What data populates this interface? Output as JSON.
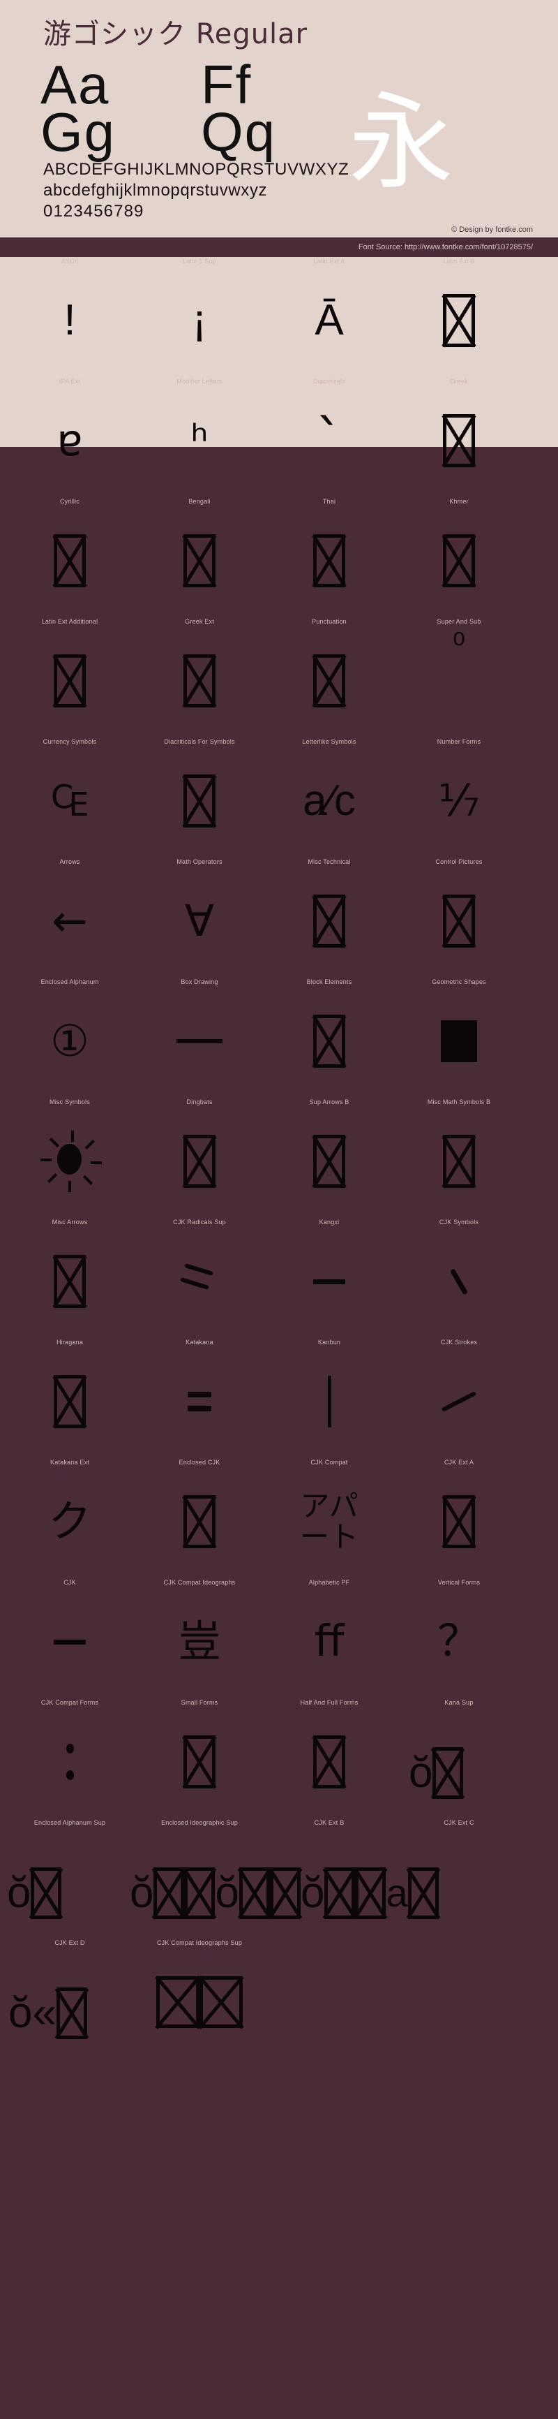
{
  "header": {
    "font_title": "游ゴシック Regular",
    "samples": [
      "Aa",
      "Ff",
      "Gg",
      "Qq"
    ],
    "cjk_sample": "永",
    "alphabet_upper": "ABCDEFGHIJKLMNOPQRSTUVWXYZ",
    "alphabet_lower": "abcdefghijklmnopqrstuvwxyz",
    "digits": "0123456789",
    "credit": "© Design by fontke.com",
    "font_source": "Font Source: http://www.fontke.com/font/10728575/"
  },
  "colors": {
    "panel_bg": "#e3d3cd",
    "dark_bg": "#4a2c38",
    "glyph": "#0b0608",
    "label": "#cdb8b6",
    "title": "#4a2c38",
    "cjk_sample": "#ffffff"
  },
  "blocks": [
    {
      "label": "ASCII",
      "glyph": "!",
      "kind": "text-latin"
    },
    {
      "label": "Latin 1 Sup",
      "glyph": "¡",
      "kind": "text-latin"
    },
    {
      "label": "Latin Ext A",
      "glyph": "Ā",
      "kind": "text-latin"
    },
    {
      "label": "Latin Ext B",
      "glyph": "",
      "kind": "tofu"
    },
    {
      "label": "IPA Ext",
      "glyph": "ɐ",
      "kind": "text"
    },
    {
      "label": "Modifier Letters",
      "glyph": "ʰ",
      "kind": "text"
    },
    {
      "label": "Diacriticals",
      "glyph": "ˋ",
      "kind": "grave"
    },
    {
      "label": "Greek",
      "glyph": "",
      "kind": "tofu"
    },
    {
      "label": "Cyrillic",
      "glyph": "",
      "kind": "tofu"
    },
    {
      "label": "Bengali",
      "glyph": "",
      "kind": "tofu"
    },
    {
      "label": "Thai",
      "glyph": "",
      "kind": "tofu"
    },
    {
      "label": "Khmer",
      "glyph": "",
      "kind": "tofu"
    },
    {
      "label": "Latin Ext Additional",
      "glyph": "",
      "kind": "tofu"
    },
    {
      "label": "Greek Ext",
      "glyph": "",
      "kind": "tofu"
    },
    {
      "label": "Punctuation",
      "glyph": "",
      "kind": "tofu"
    },
    {
      "label": "Super And Sub",
      "glyph": "⁰",
      "kind": "supzero"
    },
    {
      "label": "Currency Symbols",
      "glyph": "₠",
      "kind": "text"
    },
    {
      "label": "Diacriticals For Symbols",
      "glyph": "",
      "kind": "tofu"
    },
    {
      "label": "Letterlike Symbols",
      "glyph": "a⁄c",
      "kind": "text-latin"
    },
    {
      "label": "Number Forms",
      "glyph": "⅐",
      "kind": "text"
    },
    {
      "label": "Arrows",
      "glyph": "←",
      "kind": "text"
    },
    {
      "label": "Math Operators",
      "glyph": "∀",
      "kind": "text"
    },
    {
      "label": "Misc Technical",
      "glyph": "",
      "kind": "tofu"
    },
    {
      "label": "Control Pictures",
      "glyph": "",
      "kind": "tofu"
    },
    {
      "label": "Enclosed Alphanum",
      "glyph": "①",
      "kind": "text"
    },
    {
      "label": "Box Drawing",
      "glyph": "─",
      "kind": "hrule"
    },
    {
      "label": "Block Elements",
      "glyph": "",
      "kind": "tofu"
    },
    {
      "label": "Geometric Shapes",
      "glyph": "■",
      "kind": "solid"
    },
    {
      "label": "Misc Symbols",
      "glyph": "☀",
      "kind": "sun"
    },
    {
      "label": "Dingbats",
      "glyph": "",
      "kind": "tofu"
    },
    {
      "label": "Sup Arrows B",
      "glyph": "",
      "kind": "tofu"
    },
    {
      "label": "Misc Math Symbols B",
      "glyph": "",
      "kind": "tofu"
    },
    {
      "label": "Misc Arrows",
      "glyph": "",
      "kind": "tofu"
    },
    {
      "label": "CJK Radicals Sup",
      "glyph": "⺀",
      "kind": "strokes2"
    },
    {
      "label": "Kangxi",
      "glyph": "⼀",
      "kind": "hrule-short"
    },
    {
      "label": "CJK Symbols",
      "glyph": "、",
      "kind": "diag-steep"
    },
    {
      "label": "Hiragana",
      "glyph": "",
      "kind": "tofu"
    },
    {
      "label": "Katakana",
      "glyph": "゠",
      "kind": "dbldash"
    },
    {
      "label": "Kanbun",
      "glyph": "㆐",
      "kind": "vrule"
    },
    {
      "label": "CJK Strokes",
      "glyph": "㇀",
      "kind": "diag"
    },
    {
      "label": "Katakana Ext",
      "glyph": "ク",
      "kind": "text"
    },
    {
      "label": "Enclosed CJK",
      "glyph": "",
      "kind": "tofu"
    },
    {
      "label": "CJK Compat",
      "glyph": "アパート",
      "kind": "apart"
    },
    {
      "label": "CJK Ext A",
      "glyph": "",
      "kind": "tofu"
    },
    {
      "label": "CJK",
      "glyph": "一",
      "kind": "hrule-short"
    },
    {
      "label": "CJK Compat Ideographs",
      "glyph": "豈",
      "kind": "text"
    },
    {
      "label": "Alphabetic PF",
      "glyph": "ﬀ",
      "kind": "text-latin"
    },
    {
      "label": "Vertical Forms",
      "glyph": "？",
      "kind": "text-latin"
    },
    {
      "label": "CJK Compat Forms",
      "glyph": "︰",
      "kind": "twodots"
    },
    {
      "label": "Small Forms",
      "glyph": "",
      "kind": "tofu"
    },
    {
      "label": "Half And Full Forms",
      "glyph": "",
      "kind": "tofu"
    },
    {
      "label": "Kana Sup",
      "glyph": "ŏ",
      "kind": "overflow-2"
    },
    {
      "label": "Enclosed Alphanum Sup",
      "glyph": "ŏ",
      "kind": "overflow-1"
    },
    {
      "label": "Enclosed Ideographic Sup",
      "glyph": "ŏ",
      "kind": "overflow-long"
    },
    {
      "label": "CJK Ext B",
      "glyph": "",
      "kind": "blank"
    },
    {
      "label": "CJK Ext C",
      "glyph": "",
      "kind": "blank"
    },
    {
      "label": "CJK Ext D",
      "glyph": "ŏ«",
      "kind": "overflow-tail"
    },
    {
      "label": "CJK Compat Ideographs Sup",
      "glyph": "",
      "kind": "tofu-wide-pair"
    }
  ]
}
